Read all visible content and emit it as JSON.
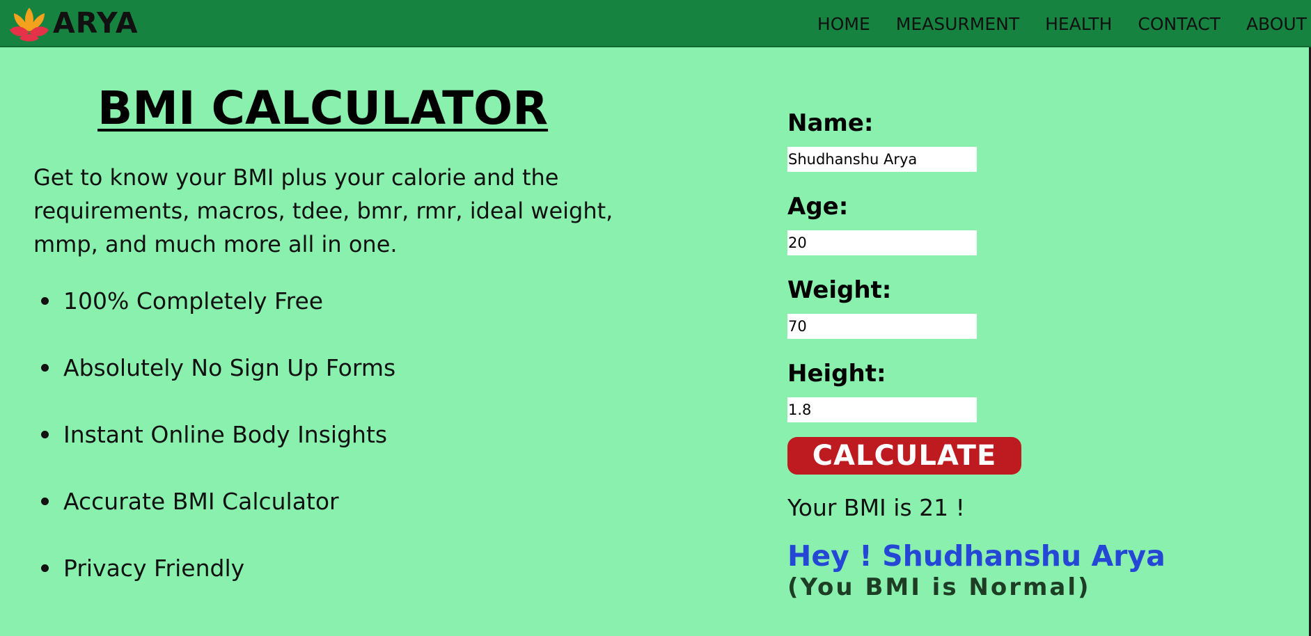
{
  "brand": {
    "name": "ARYA",
    "logo_icon": "lotus-icon",
    "colors": {
      "petal_orange": "#f4a21d",
      "petal_red": "#e63249"
    }
  },
  "nav": {
    "items": [
      {
        "label": "HOME"
      },
      {
        "label": "MEASURMENT"
      },
      {
        "label": "HEALTH"
      },
      {
        "label": "CONTACT"
      },
      {
        "label": "ABOUT"
      }
    ]
  },
  "main": {
    "title": "BMI CALCULATOR",
    "intro": "Get to know your BMI plus your calorie and the requirements, macros, tdee, bmr, rmr, ideal weight, mmp, and much more all in one.",
    "features": [
      "100% Completely Free",
      "Absolutely No Sign Up Forms",
      "Instant Online Body Insights",
      "Accurate BMI Calculator",
      "Privacy Friendly"
    ]
  },
  "form": {
    "name_label": "Name:",
    "name_value": "Shudhanshu Arya",
    "age_label": "Age:",
    "age_value": "20",
    "weight_label": "Weight:",
    "weight_value": "70",
    "height_label": "Height:",
    "height_value": "1.8",
    "button_label": "CALCULATE"
  },
  "result": {
    "bmi_text": "Your BMI is 21 !",
    "greeting": "Hey ! Shudhanshu Arya",
    "status": "(You BMI is Normal)"
  },
  "colors": {
    "page_bg": "#8af0ae",
    "navbar_bg": "#168340",
    "button_bg": "#be1b21",
    "greeting_text": "#2547d6",
    "status_text": "#1e3d25"
  }
}
